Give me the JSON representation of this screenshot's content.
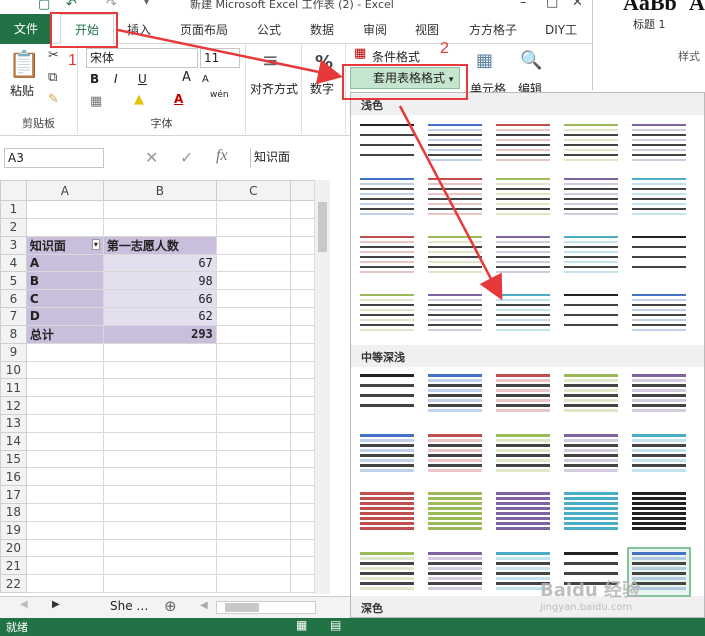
{
  "title_bar": {
    "title": "新建 Microsoft Excel 工作表 (2) - Excel",
    "min": "–",
    "restore": "□",
    "close": "✕"
  },
  "tabs": {
    "file": "文件",
    "home": "开始",
    "insert": "插入",
    "layout": "页面布局",
    "formula": "公式",
    "data": "数据",
    "review": "审阅",
    "view": "视图",
    "ffgz": "方方格子",
    "diy": "DIY工"
  },
  "annotations": {
    "n1": "1",
    "n2": "2"
  },
  "ribbon": {
    "paste": "粘贴",
    "clipboard": "剪贴板",
    "font_name": "宋体",
    "font_size": "11",
    "bold": "B",
    "italic": "I",
    "underline": "U",
    "font_group": "字体",
    "align": "对齐方式",
    "number": "数字",
    "number_symbol": "%",
    "cond_format": "条件格式",
    "table_format": "套用表格格式",
    "cells": "单元格",
    "edit": "编辑",
    "wen": "wén",
    "font_color_a": "A",
    "grow_a": "A",
    "shrink_a": "A"
  },
  "other_window": {
    "sample": "AaBb",
    "sample2": "A",
    "heading": "标题 1",
    "styles": "样式"
  },
  "formula_bar": {
    "name_box": "A3",
    "formula": "知识面",
    "fx": "fx",
    "cancel": "✕",
    "enter": "✓"
  },
  "sheet": {
    "col_headers": [
      "A",
      "B",
      "C"
    ],
    "row_numbers": [
      "1",
      "2",
      "3",
      "4",
      "5",
      "6",
      "7",
      "8",
      "9",
      "10",
      "11",
      "12",
      "13",
      "14",
      "15",
      "16",
      "17",
      "18",
      "19",
      "20",
      "21",
      "22"
    ],
    "header": {
      "a": "知识面",
      "b": "第一志愿人数"
    },
    "rows": [
      {
        "label": "A",
        "value": "67"
      },
      {
        "label": "B",
        "value": "98"
      },
      {
        "label": "C",
        "value": "66"
      },
      {
        "label": "D",
        "value": "62"
      }
    ],
    "total": {
      "label": "总计",
      "value": "293"
    },
    "tab": "She …"
  },
  "gallery": {
    "light": "浅色",
    "medium": "中等深浅",
    "dark": "深色"
  },
  "status": {
    "ready": "就绪"
  },
  "watermark": {
    "text": "Baidu 经验",
    "url": "jingyan.baidu.com"
  },
  "colors": {
    "excel_green": "#217346",
    "pivot_dark": "#c9bedb",
    "pivot_light": "#e4dfee",
    "annotation_red": "#e8393a"
  }
}
